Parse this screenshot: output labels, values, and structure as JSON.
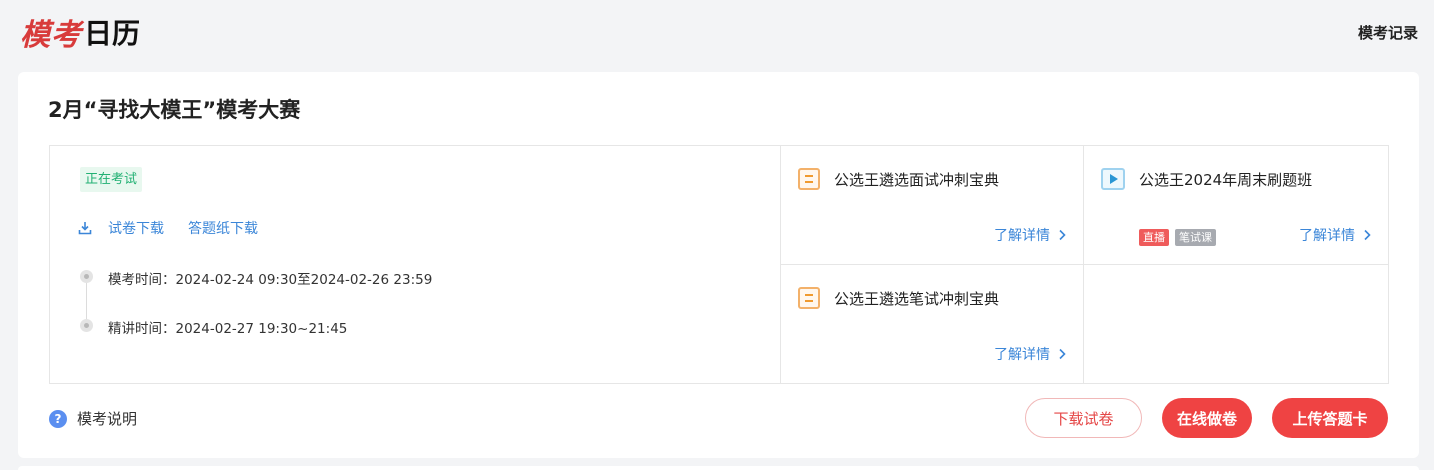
{
  "header": {
    "logo_part1": "模考",
    "logo_part2": "日历",
    "record_link": "模考记录"
  },
  "exam": {
    "title": "2月“寻找大模王”模考大赛",
    "status": "正在考试",
    "download_paper": "试卷下载",
    "download_answer_sheet": "答题纸下载",
    "exam_time": "模考时间：2024-02-24 09:30至2024-02-26 23:59",
    "lecture_time": "精讲时间：2024-02-27 19:30~21:45"
  },
  "products": [
    {
      "title": "公选王遴选面试冲刺宝典",
      "more": "了解详情",
      "icon": "doc-icon"
    },
    {
      "title": "公选王2024年周末刷题班",
      "more": "了解详情",
      "icon": "play-icon",
      "tags": [
        "直播",
        "笔试课"
      ]
    },
    {
      "title": "公选王遴选笔试冲刺宝典",
      "more": "了解详情",
      "icon": "doc-icon"
    }
  ],
  "footer": {
    "explain": "模考说明",
    "download_btn": "下载试卷",
    "online_btn": "在线做卷",
    "upload_btn": "上传答题卡"
  },
  "colors": {
    "accent_red": "#ef4343",
    "link_blue": "#3b86d8",
    "status_green": "#22b073"
  }
}
